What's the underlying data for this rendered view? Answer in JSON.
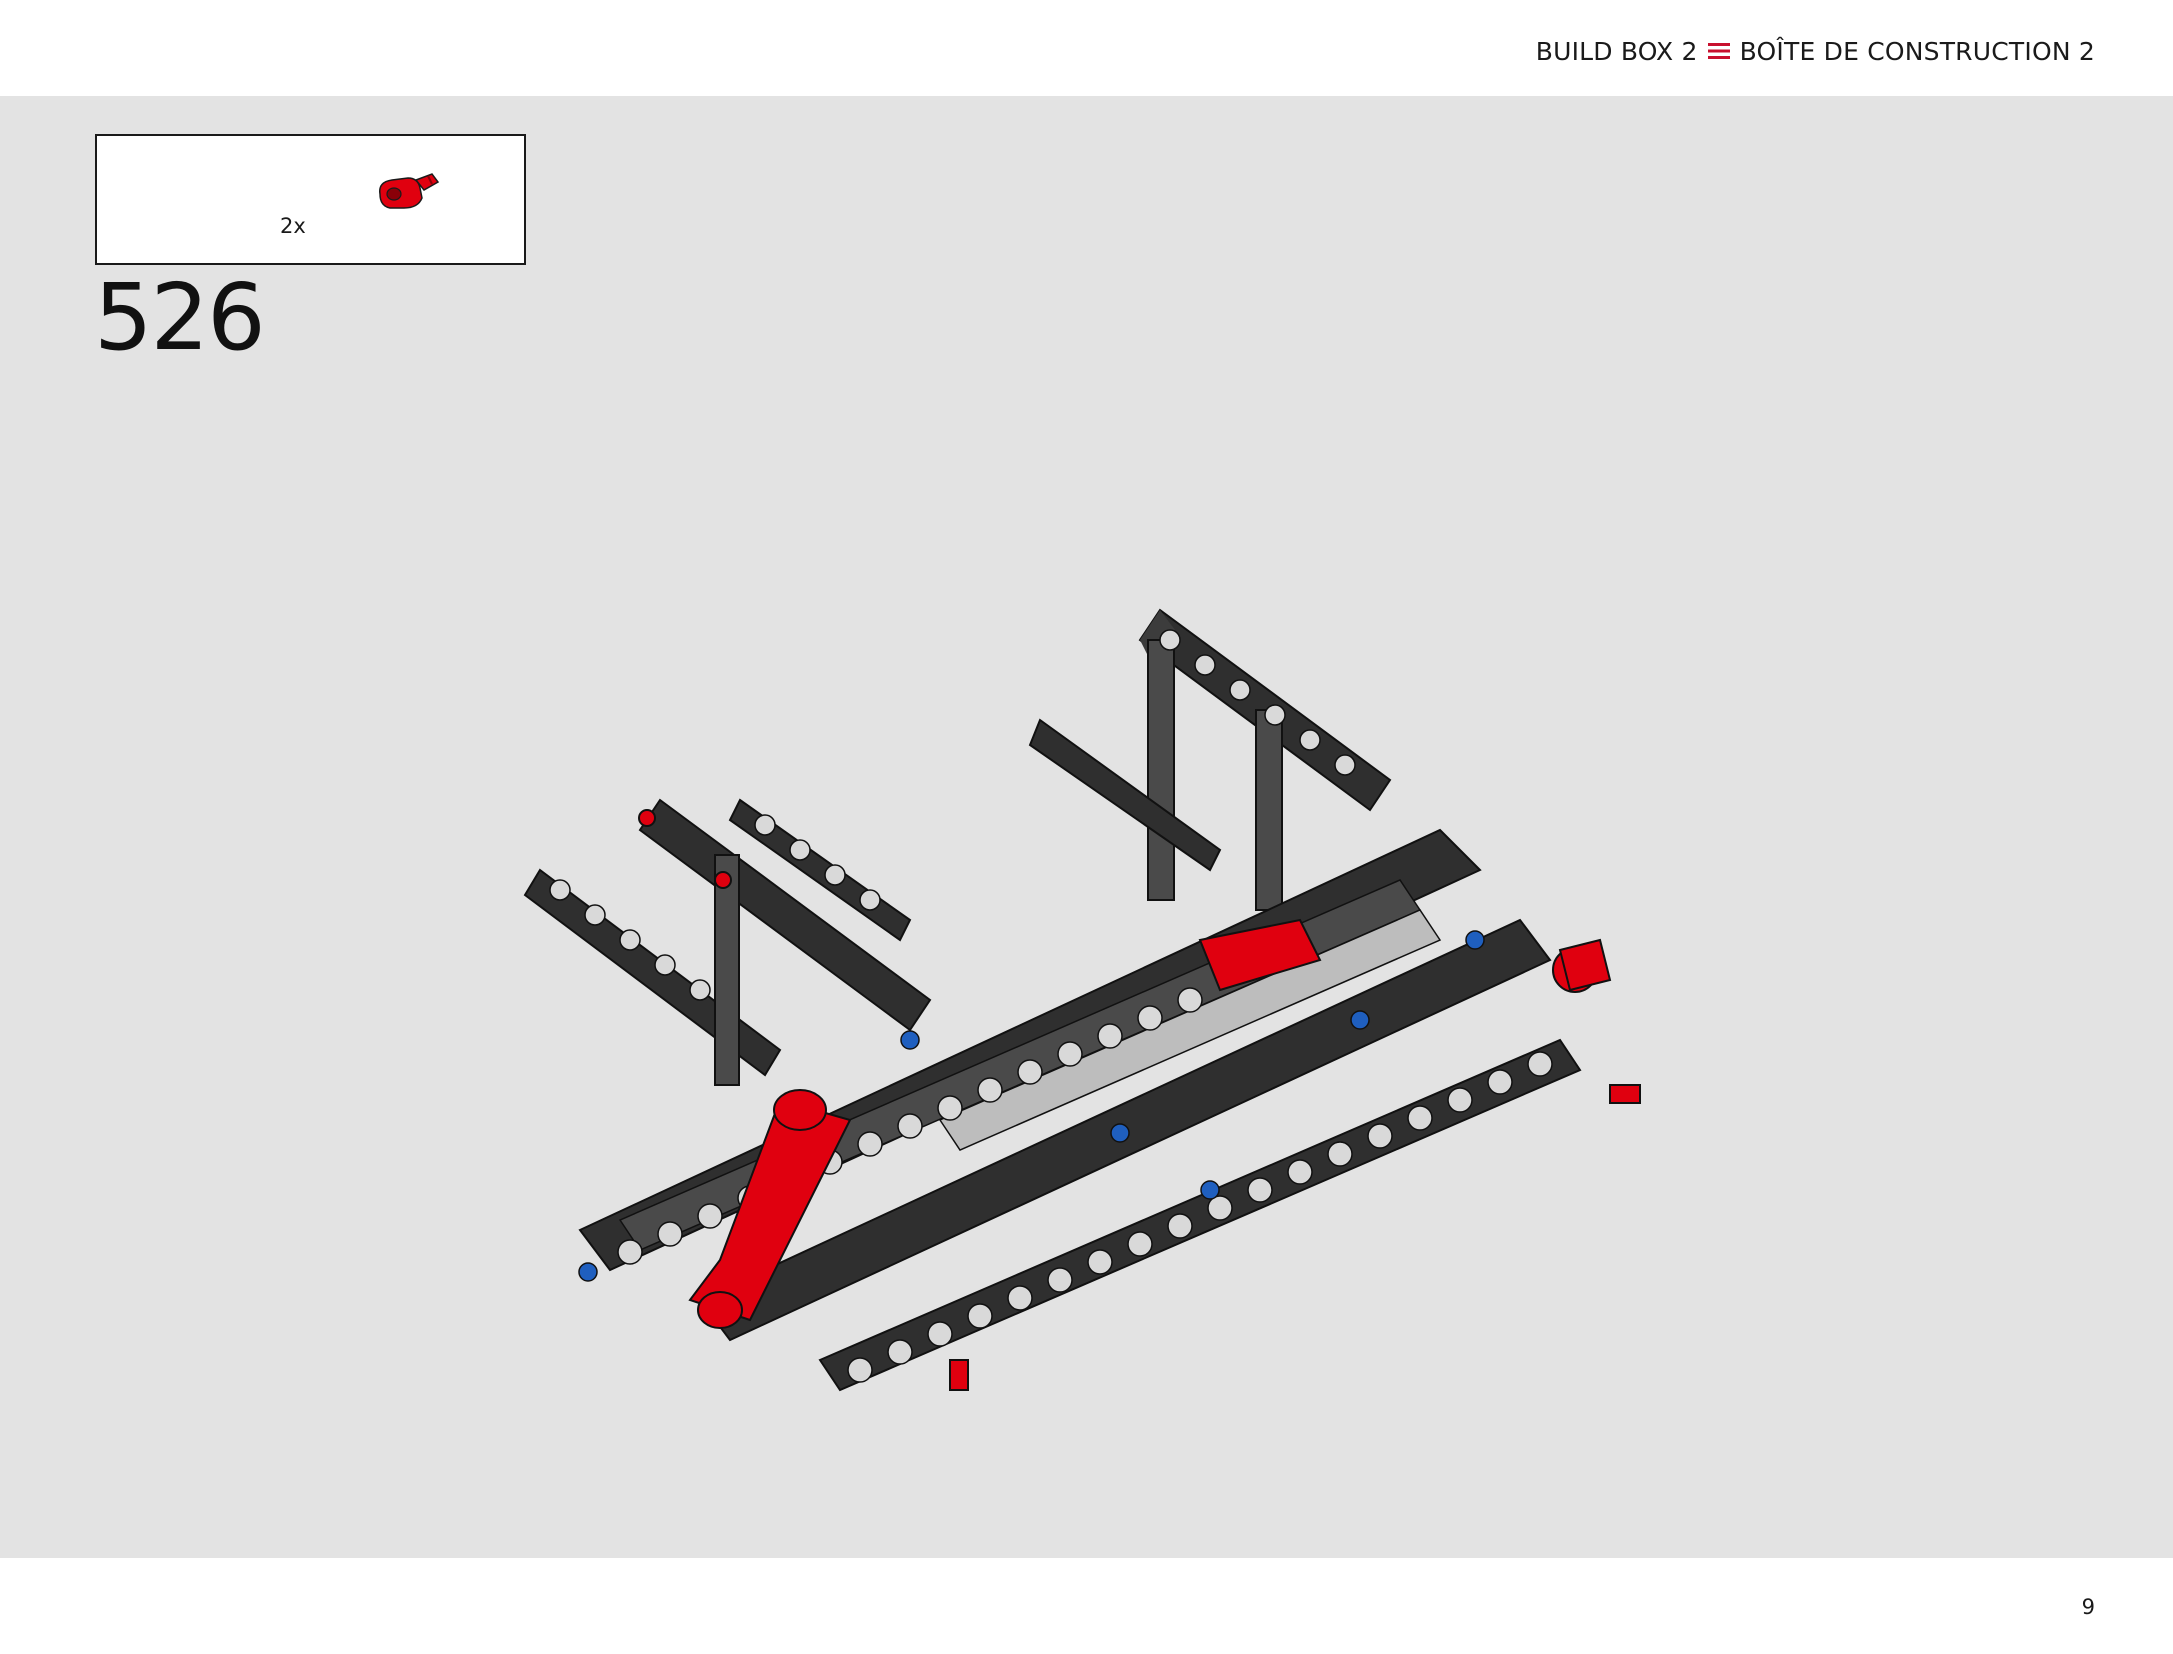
{
  "header": {
    "build_box_en": "BUILD BOX 2",
    "separator_icon": "triple-line-icon",
    "build_box_fr": "BOÎTE DE CONSTRUCTION 2",
    "accent_color": "#c8102e"
  },
  "parts_callout": {
    "part_icon": "red-technic-connector-icon",
    "quantity": "2x"
  },
  "step": {
    "number": "526"
  },
  "model": {
    "illustration_icon": "technic-chassis-assembly-icon",
    "colors": {
      "beam": "#2f2f2f",
      "hole_ring": "#d9d9d9",
      "accent_part": "#e0000f",
      "pin_blue": "#1f5fbf",
      "light_gray": "#bdbdbd"
    }
  },
  "footer": {
    "page_number": "9"
  }
}
